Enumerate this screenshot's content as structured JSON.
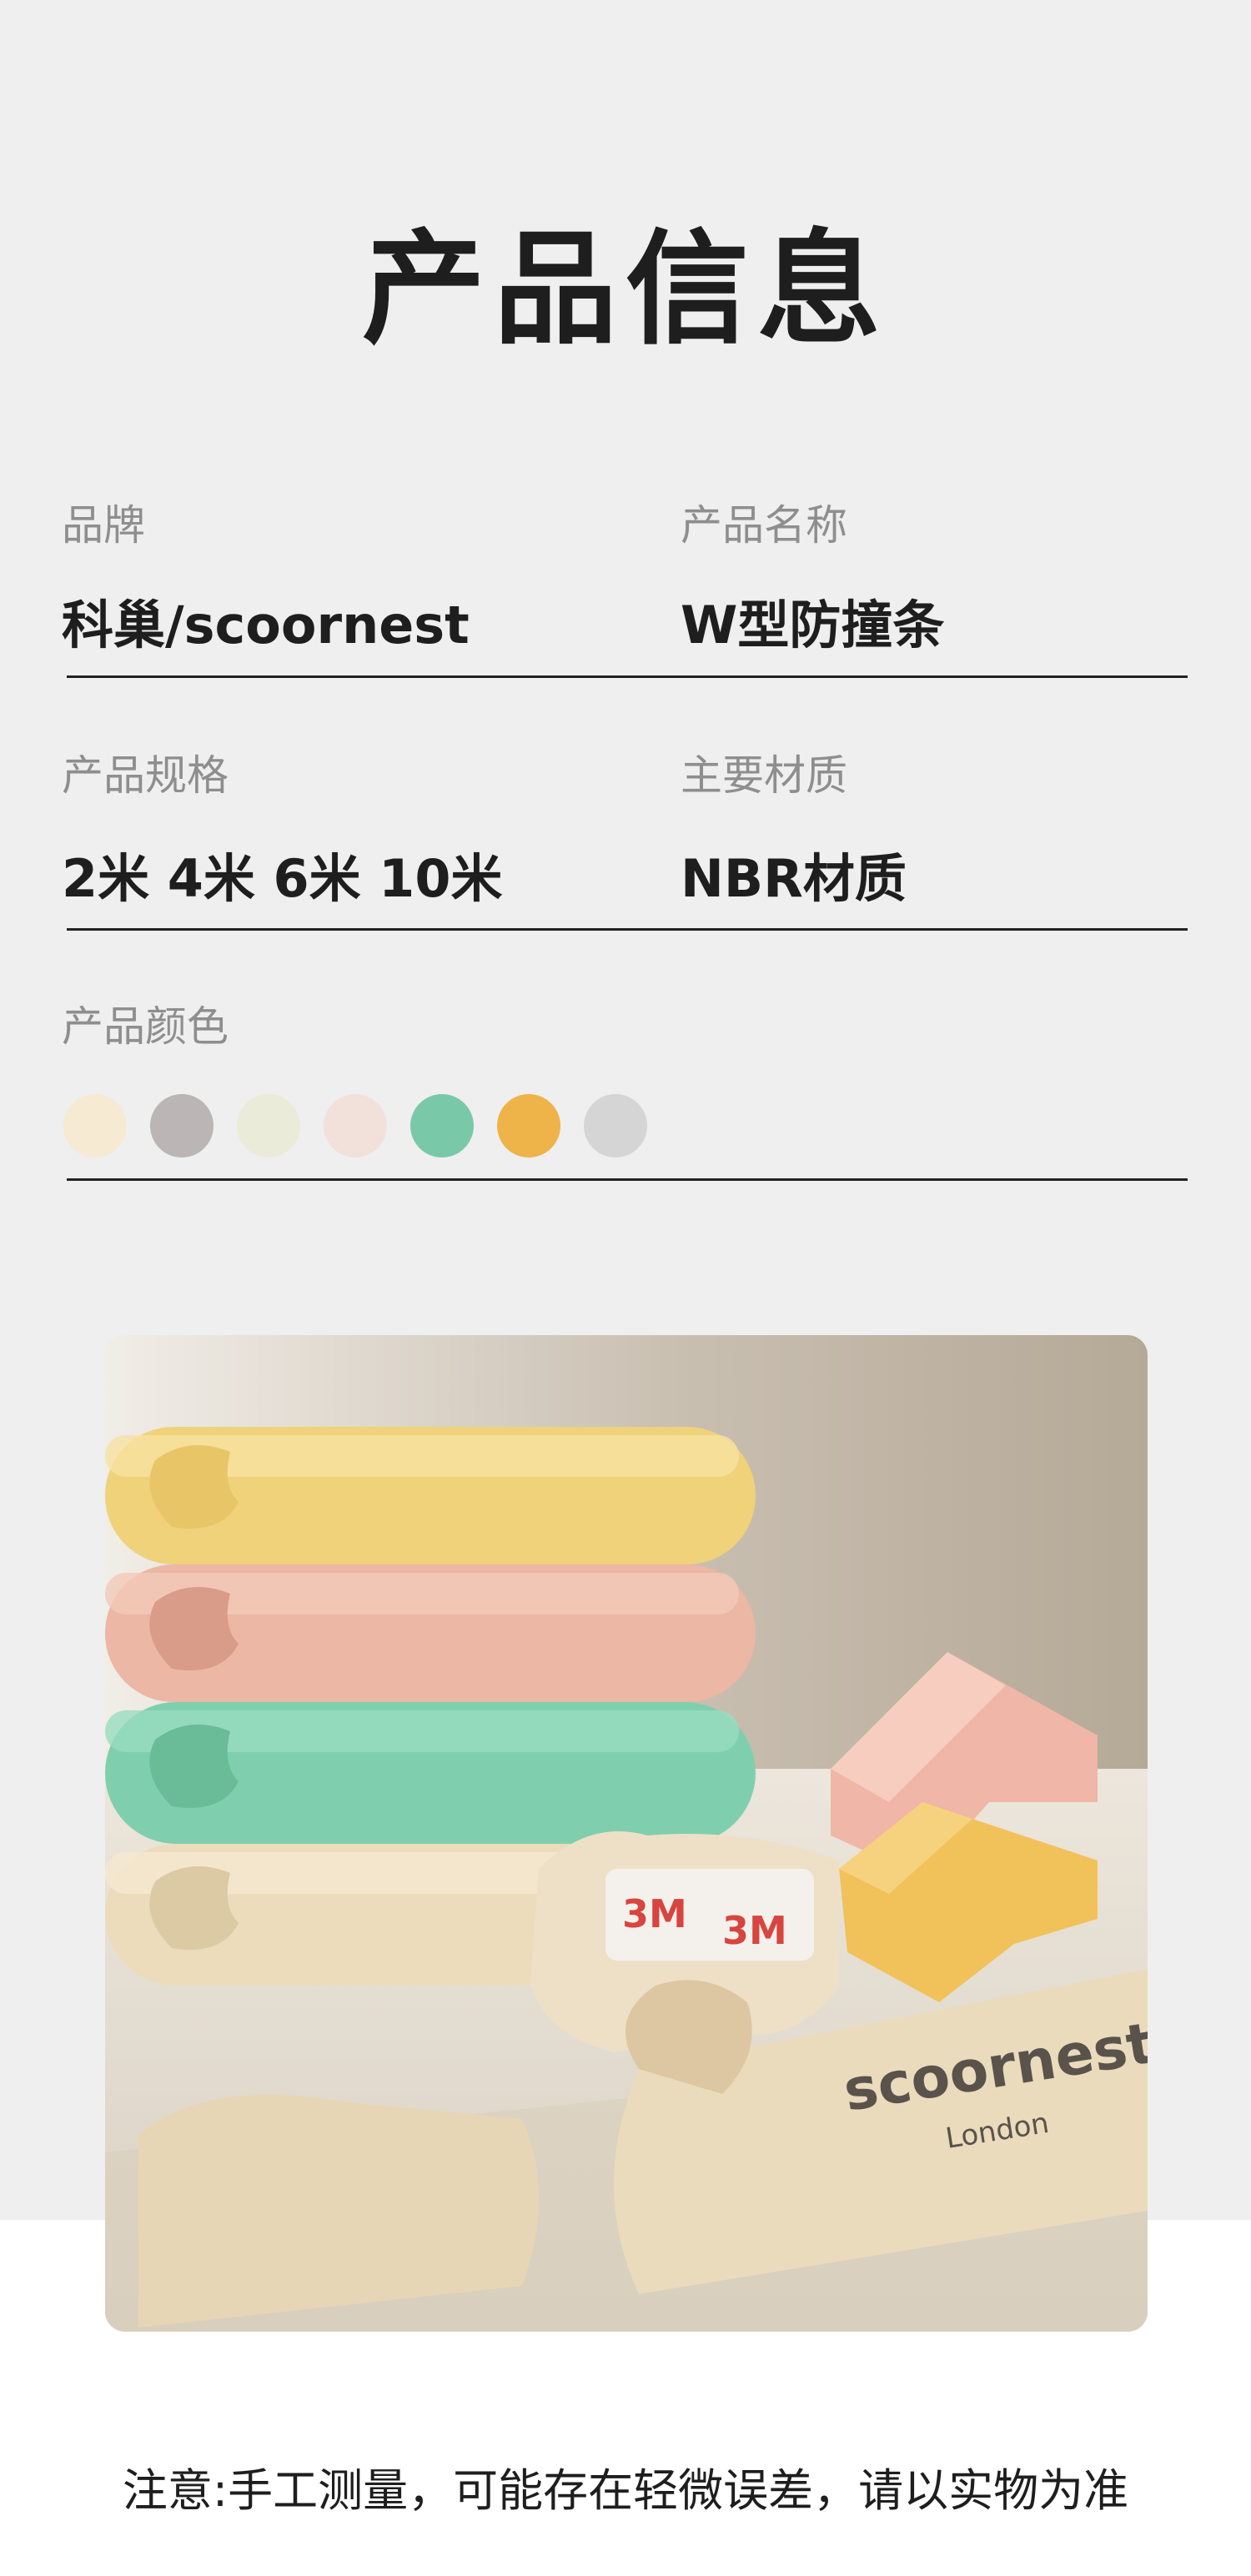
{
  "title": "产品信息",
  "fields": {
    "brand": {
      "label": "品牌",
      "value": "科巢/scoornest"
    },
    "product_name": {
      "label": "产品名称",
      "value": "W型防撞条"
    },
    "spec": {
      "label": "产品规格",
      "value": "2米 4米 6米 10米"
    },
    "material": {
      "label": "主要材质",
      "value": "NBR材质"
    },
    "colors": {
      "label": "产品颜色",
      "swatches": [
        "#f7ead3",
        "#bbb5b5",
        "#ebebd9",
        "#f2e1db",
        "#79c9a8",
        "#eeb349",
        "#d5d5d5"
      ]
    }
  },
  "photo": {
    "logo_text": "scoornest",
    "logo_sub": "London",
    "tape_text": "3M"
  },
  "footer_note": "注意:手工测量，可能存在轻微误差，请以实物为准"
}
